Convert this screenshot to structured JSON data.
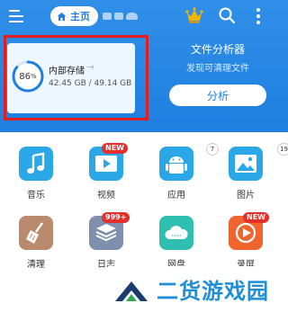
{
  "header": {
    "breadcrumb_home": "主页"
  },
  "storage": {
    "percent_label": "86",
    "percent_unit": "%",
    "used_fraction": 0.86,
    "title": "内部存储",
    "arrow": "→",
    "usage": "42.45 GB / 49.14 GB"
  },
  "analyzer": {
    "title": "文件分析器",
    "subtitle": "发现可清理文件",
    "button": "分析"
  },
  "categories": [
    {
      "label": "音乐",
      "icon": "music-icon"
    },
    {
      "label": "视频",
      "icon": "video-icon",
      "badge": "NEW"
    },
    {
      "label": "应用",
      "icon": "android-icon",
      "badge": "7"
    },
    {
      "label": "图片",
      "icon": "image-icon",
      "badge": "19"
    },
    {
      "label": "清理",
      "icon": "broom-icon"
    },
    {
      "label": "日志",
      "icon": "log-icon",
      "badge": "999+"
    },
    {
      "label": "网盘",
      "icon": "cloud-drive-icon"
    },
    {
      "label": "录屏",
      "icon": "screen-record-icon",
      "badge": "NEW"
    }
  ],
  "watermark": {
    "text": "二货游戏园"
  },
  "colors": {
    "header_blue": "#1f7fe0",
    "highlight_red": "#e11d1d",
    "badge_red": "#e5302a"
  }
}
